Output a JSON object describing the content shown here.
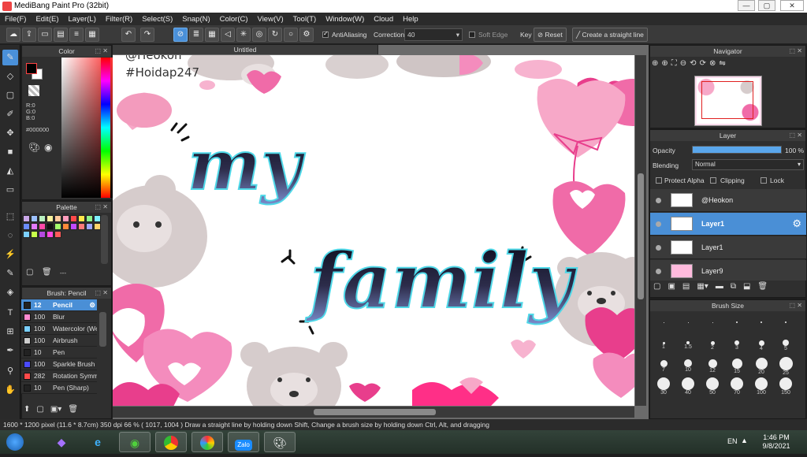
{
  "window": {
    "title": "MediBang Paint Pro (32bit)",
    "min": "—",
    "max": "▢",
    "close": "✕"
  },
  "menu": [
    "File(F)",
    "Edit(E)",
    "Layer(L)",
    "Filter(R)",
    "Select(S)",
    "Snap(N)",
    "Color(C)",
    "View(V)",
    "Tool(T)",
    "Window(W)",
    "Cloud",
    "Help"
  ],
  "toolbar": {
    "antialiasing": "AntiAliasing",
    "correction_label": "Correction",
    "correction_value": "40",
    "soft_edge": "Soft Edge",
    "key_label": "Key",
    "reset": "Reset",
    "straight_line": "Create a straight line"
  },
  "color_panel": {
    "title": "Color",
    "r": "R:0",
    "g": "G:0",
    "b": "B:0",
    "hex": "#000000",
    "fg": "#000000",
    "bg": "#ffffff"
  },
  "palette_panel": {
    "title": "Palette",
    "colors": [
      "#c9a7e8",
      "#9cc1ff",
      "#b9f0c0",
      "#f7f29c",
      "#ffc89c",
      "#ff9cbc",
      "#ff4a4a",
      "#ffe74a",
      "#8ef28a",
      "#7ff0ff",
      "#6b8cff",
      "#e27bff",
      "#ff4aa8",
      "#111111",
      "#a4ff6b",
      "#ff8a3a",
      "#c04aff",
      "#ff7a7a",
      "#9ea6ff",
      "#ffd36b",
      "#7cd0ff",
      "#c8ff4a",
      "#b44ae0",
      "#ff4ae0",
      "#ff5a5a"
    ],
    "more": "---"
  },
  "brush_panel": {
    "title": "Brush: Pencil",
    "items": [
      {
        "size": "12",
        "name": "Pencil",
        "color": "#222222"
      },
      {
        "size": "100",
        "name": "Blur",
        "color": "#ff8ad0"
      },
      {
        "size": "100",
        "name": "Watercolor (Wet)",
        "color": "#7ad0ff"
      },
      {
        "size": "100",
        "name": "Airbrush",
        "color": "#cccccc"
      },
      {
        "size": "10",
        "name": "Pen",
        "color": "#222222"
      },
      {
        "size": "100",
        "name": "Sparkle Brush",
        "color": "#4a4aff"
      },
      {
        "size": "282",
        "name": "Rotation Symmetry",
        "color": "#ff4a4a"
      },
      {
        "size": "10",
        "name": "Pen (Sharp)",
        "color": "#222222"
      }
    ]
  },
  "document": {
    "tab": "Untitled",
    "watermark1": "@Heokon",
    "watermark2": "#Hoidap247",
    "word1": "my",
    "word2": "family"
  },
  "navigator": {
    "title": "Navigator"
  },
  "layer_panel": {
    "title": "Layer",
    "opacity_label": "Opacity",
    "opacity_value": "100 %",
    "opacity_fraction": 1.0,
    "blending_label": "Blending",
    "blending_value": "Normal",
    "protect_alpha": "Protect Alpha",
    "clipping": "Clipping",
    "lock": "Lock",
    "layers": [
      {
        "name": "@Heokon",
        "selected": false
      },
      {
        "name": "Layer1",
        "selected": true
      },
      {
        "name": "Layer1",
        "selected": false
      },
      {
        "name": "Layer9",
        "selected": false
      }
    ]
  },
  "brush_size": {
    "title": "Brush Size",
    "sizes": [
      ".",
      ".",
      ".",
      ".",
      ".",
      ".",
      "1",
      "1.5",
      "2",
      "3",
      "4",
      "5",
      "7",
      "10",
      "12",
      "15",
      "20",
      "25",
      "30",
      "40",
      "50",
      "70",
      "100",
      "150"
    ]
  },
  "status": {
    "text": "1600 * 1200 pixel  (11.6 * 8.7cm)  350 dpi  66 %  ( 1017, 1004 )  Draw a straight line by holding down Shift, Change a brush size by holding down Ctrl, Alt, and dragging"
  },
  "taskbar": {
    "lang": "EN",
    "time": "1:46 PM",
    "date": "9/8/2021",
    "zalo": "Zalo"
  }
}
